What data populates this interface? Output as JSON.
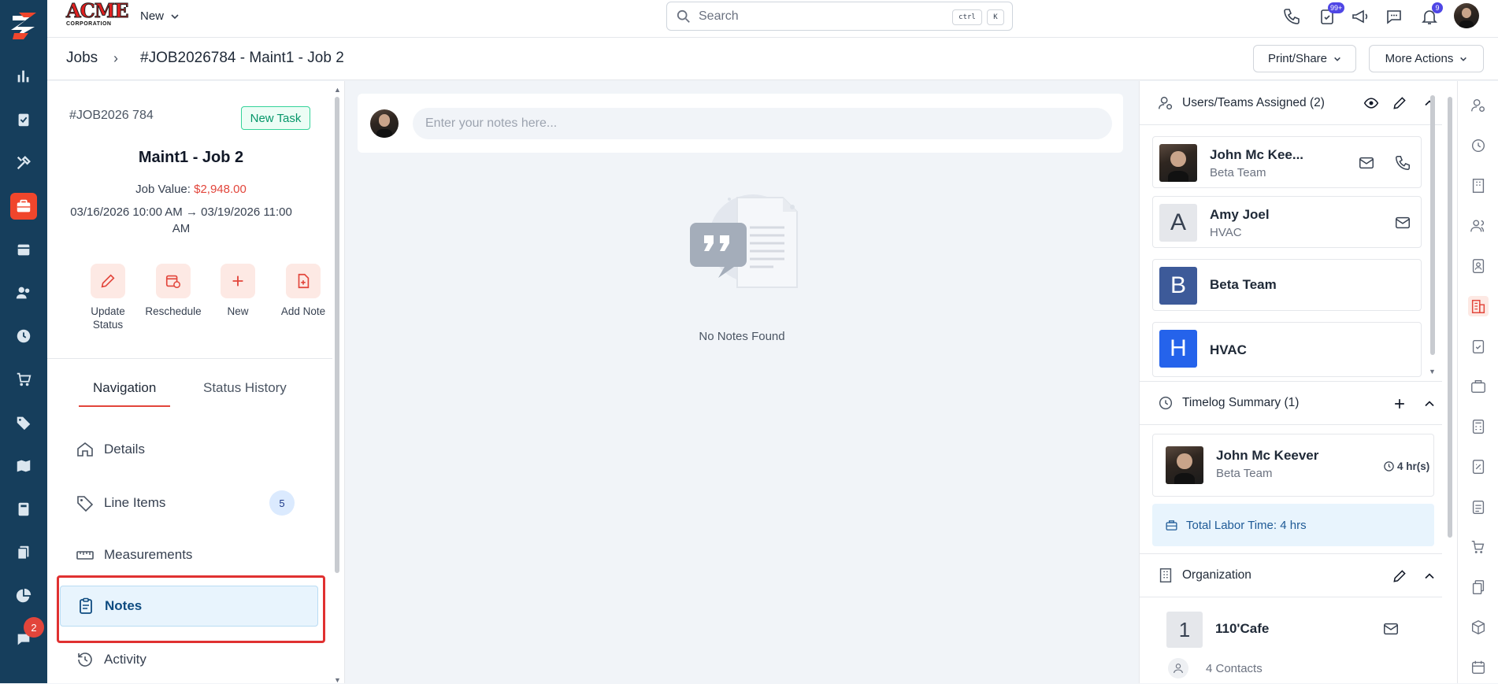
{
  "topbar": {
    "brand_line1": "ACME",
    "brand_line2": "CORPORATION",
    "new_label": "New",
    "search_placeholder": "Search",
    "kbd_ctrl": "ctrl",
    "kbd_k": "K",
    "badge_tasks": "99+",
    "badge_bell": "9"
  },
  "rail": {
    "chat_badge": "2"
  },
  "breadcrumb": {
    "jobs": "Jobs",
    "sep": "›",
    "title": "#JOB2026784 - Maint1 - Job 2",
    "print_share": "Print/Share",
    "more_actions": "More Actions"
  },
  "job": {
    "number": "#JOB2026 784",
    "status": "New Task",
    "name": "Maint1 - Job 2",
    "value_label": "Job Value:",
    "value": "$2,948.00",
    "dates": "03/16/2026 10:00 AM → 03/19/2026 11:00 AM"
  },
  "actions": [
    {
      "label": "Update Status"
    },
    {
      "label": "Reschedule"
    },
    {
      "label": "New"
    },
    {
      "label": "Add Note"
    }
  ],
  "tabs": {
    "navigation": "Navigation",
    "status_history": "Status History"
  },
  "nav": {
    "details": "Details",
    "line_items": "Line Items",
    "line_items_count": "5",
    "measurements": "Measurements",
    "notes": "Notes",
    "activity": "Activity"
  },
  "notes": {
    "placeholder": "Enter your notes here...",
    "empty": "No Notes Found"
  },
  "assigned": {
    "title": "Users/Teams Assigned (2)",
    "items": [
      {
        "name": "John Mc Kee...",
        "sub": "Beta Team"
      },
      {
        "name": "Amy Joel",
        "sub": "HVAC",
        "letter": "A"
      },
      {
        "name": "Beta Team",
        "letter": "B"
      },
      {
        "name": "HVAC",
        "letter": "H"
      }
    ]
  },
  "timelog": {
    "title": "Timelog Summary (1)",
    "name": "John Mc Keever",
    "team": "Beta Team",
    "hours": "4 hr(s)",
    "total": "Total Labor Time: 4 hrs"
  },
  "organization": {
    "title": "Organization",
    "letter": "1",
    "name": "110'Cafe",
    "contacts": "4 Contacts"
  },
  "colors": {
    "rail_bg": "#163e5c",
    "accent": "#f0462c",
    "link_blue": "#0f4c81"
  }
}
